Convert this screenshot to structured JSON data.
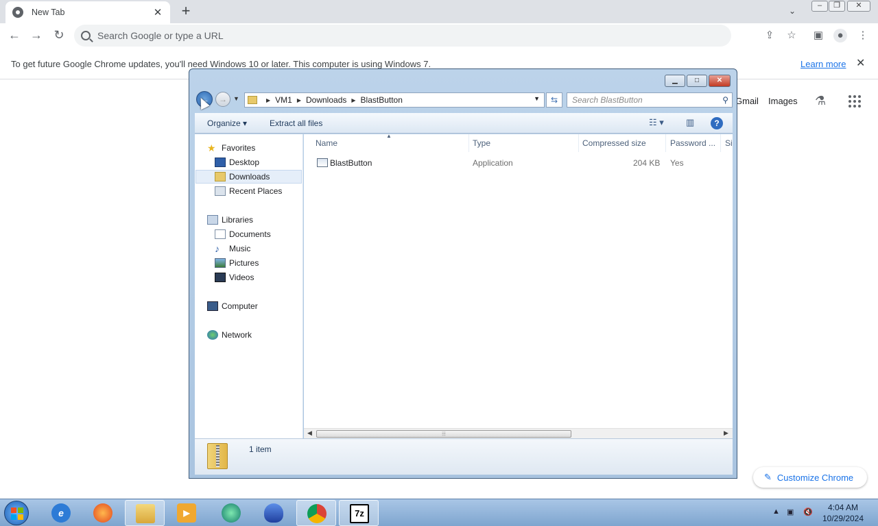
{
  "chrome": {
    "tab_title": "New Tab",
    "tab_close": "✕",
    "new_tab": "+",
    "omnibox_placeholder": "Search Google or type a URL",
    "infobar_message": "To get future Google Chrome updates, you'll need Windows 10 or later. This computer is using Windows 7.",
    "infobar_link": "Learn more",
    "infobar_close": "✕",
    "ntp_links": [
      "Gmail",
      "Images"
    ],
    "customize_label": "Customize Chrome"
  },
  "explorer": {
    "breadcrumb": [
      "VM1",
      "Downloads",
      "BlastButton"
    ],
    "search_placeholder": "Search BlastButton",
    "commands": {
      "organize": "Organize ▾",
      "extract": "Extract all files"
    },
    "nav": {
      "favorites": "Favorites",
      "favorites_items": [
        "Desktop",
        "Downloads",
        "Recent Places"
      ],
      "libraries": "Libraries",
      "libraries_items": [
        "Documents",
        "Music",
        "Pictures",
        "Videos"
      ],
      "computer": "Computer",
      "network": "Network",
      "selected": "Downloads"
    },
    "columns": [
      "Name",
      "Type",
      "Compressed size",
      "Password ...",
      "Si"
    ],
    "files": [
      {
        "name": "BlastButton",
        "type": "Application",
        "compressed_size": "204 KB",
        "password": "Yes"
      }
    ],
    "item_count": "1 item"
  },
  "taskbar": {
    "apps": [
      "Internet Explorer",
      "Firefox",
      "Windows Explorer",
      "Media Player",
      "App",
      "App",
      "Chrome",
      "7-Zip"
    ],
    "active_index": 2,
    "time": "4:04 AM",
    "date": "10/29/2024",
    "sevenzip_label": "7z"
  },
  "colors": {
    "accent": "#1a73e8",
    "taskbar": "#7ea5cf"
  }
}
